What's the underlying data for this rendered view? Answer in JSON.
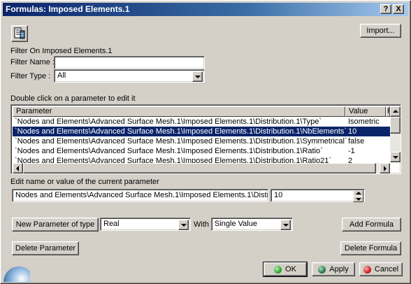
{
  "window": {
    "title": "Formulas: Imposed Elements.1",
    "help_glyph": "?",
    "close_glyph": "X"
  },
  "toolbar": {
    "filter_icon": "formula-filter-icon",
    "import_label": "Import..."
  },
  "filter": {
    "heading": "Filter On Imposed Elements.1",
    "name_label": "Filter Name :",
    "name_value": "",
    "type_label": "Filter Type :",
    "type_value": "All"
  },
  "parameters": {
    "instruction": "Double click on a parameter to edit it",
    "columns": [
      "Parameter",
      "Value",
      "F"
    ],
    "rows": [
      {
        "name": "`Nodes and Elements\\Advanced Surface Mesh.1\\Imposed Elements.1\\Distribution.1\\Type`",
        "value": "Isometric",
        "selected": false
      },
      {
        "name": "`Nodes and Elements\\Advanced Surface Mesh.1\\Imposed Elements.1\\Distribution.1\\NbElements`",
        "value": "10",
        "selected": true
      },
      {
        "name": "`Nodes and Elements\\Advanced Surface Mesh.1\\Imposed Elements.1\\Distribution.1\\Symmetrical`",
        "value": "false",
        "selected": false
      },
      {
        "name": "`Nodes and Elements\\Advanced Surface Mesh.1\\Imposed Elements.1\\Distribution.1\\Ratio`",
        "value": "-1",
        "selected": false
      },
      {
        "name": "`Nodes and Elements\\Advanced Surface Mesh.1\\Imposed Elements.1\\Distribution.1\\Ratio21`",
        "value": "2",
        "selected": false
      }
    ]
  },
  "edit": {
    "label": "Edit name or value of the current parameter",
    "name_value": "Nodes and Elements\\Advanced Surface Mesh.1\\Imposed Elements.1\\Distrib",
    "value": "10"
  },
  "new_param": {
    "button_label": "New Parameter of type",
    "type_value": "Real",
    "with_label": "With",
    "with_value": "Single Value",
    "add_formula_label": "Add Formula"
  },
  "actions": {
    "delete_parameter_label": "Delete Parameter",
    "delete_formula_label": "Delete Formula",
    "ok_label": "OK",
    "apply_label": "Apply",
    "cancel_label": "Cancel"
  },
  "colors": {
    "title_start": "#0a246a",
    "selection": "#0a246a",
    "ok_dot": "#2fa82f",
    "apply_dot": "#2d7a4a",
    "cancel_dot": "#d02020"
  }
}
